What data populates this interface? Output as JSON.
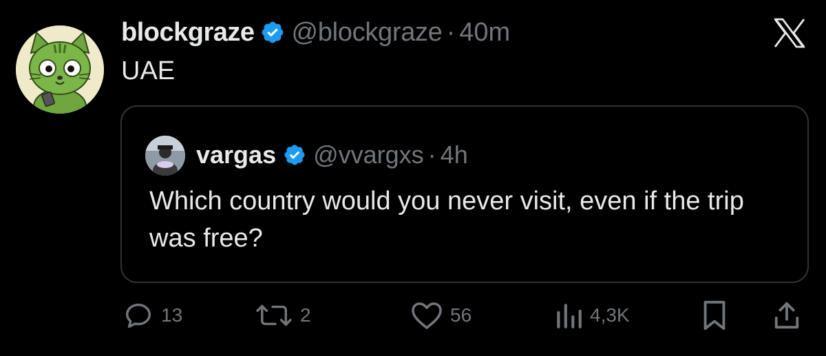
{
  "tweet": {
    "author_name": "blockgraze",
    "handle": "@blockgraze",
    "separator": "·",
    "time": "40m",
    "text": "UAE"
  },
  "quoted": {
    "author_name": "vargas",
    "handle": "@vvargxs",
    "separator": "·",
    "time": "4h",
    "text": "Which country would you never visit, even if the trip was free?"
  },
  "actions": {
    "replies": "13",
    "reposts": "2",
    "likes": "56",
    "views": "4,3K"
  },
  "icons": {
    "verified": "verified-badge-icon",
    "platform": "x-logo-icon",
    "reply": "reply-icon",
    "repost": "repost-icon",
    "like": "heart-icon",
    "views": "views-chart-icon",
    "bookmark": "bookmark-icon",
    "share": "share-icon"
  },
  "colors": {
    "background": "#000000",
    "text_primary": "#e7e9ea",
    "text_secondary": "#71767b",
    "verified_blue": "#1d9bf0",
    "border": "#2f3336"
  }
}
